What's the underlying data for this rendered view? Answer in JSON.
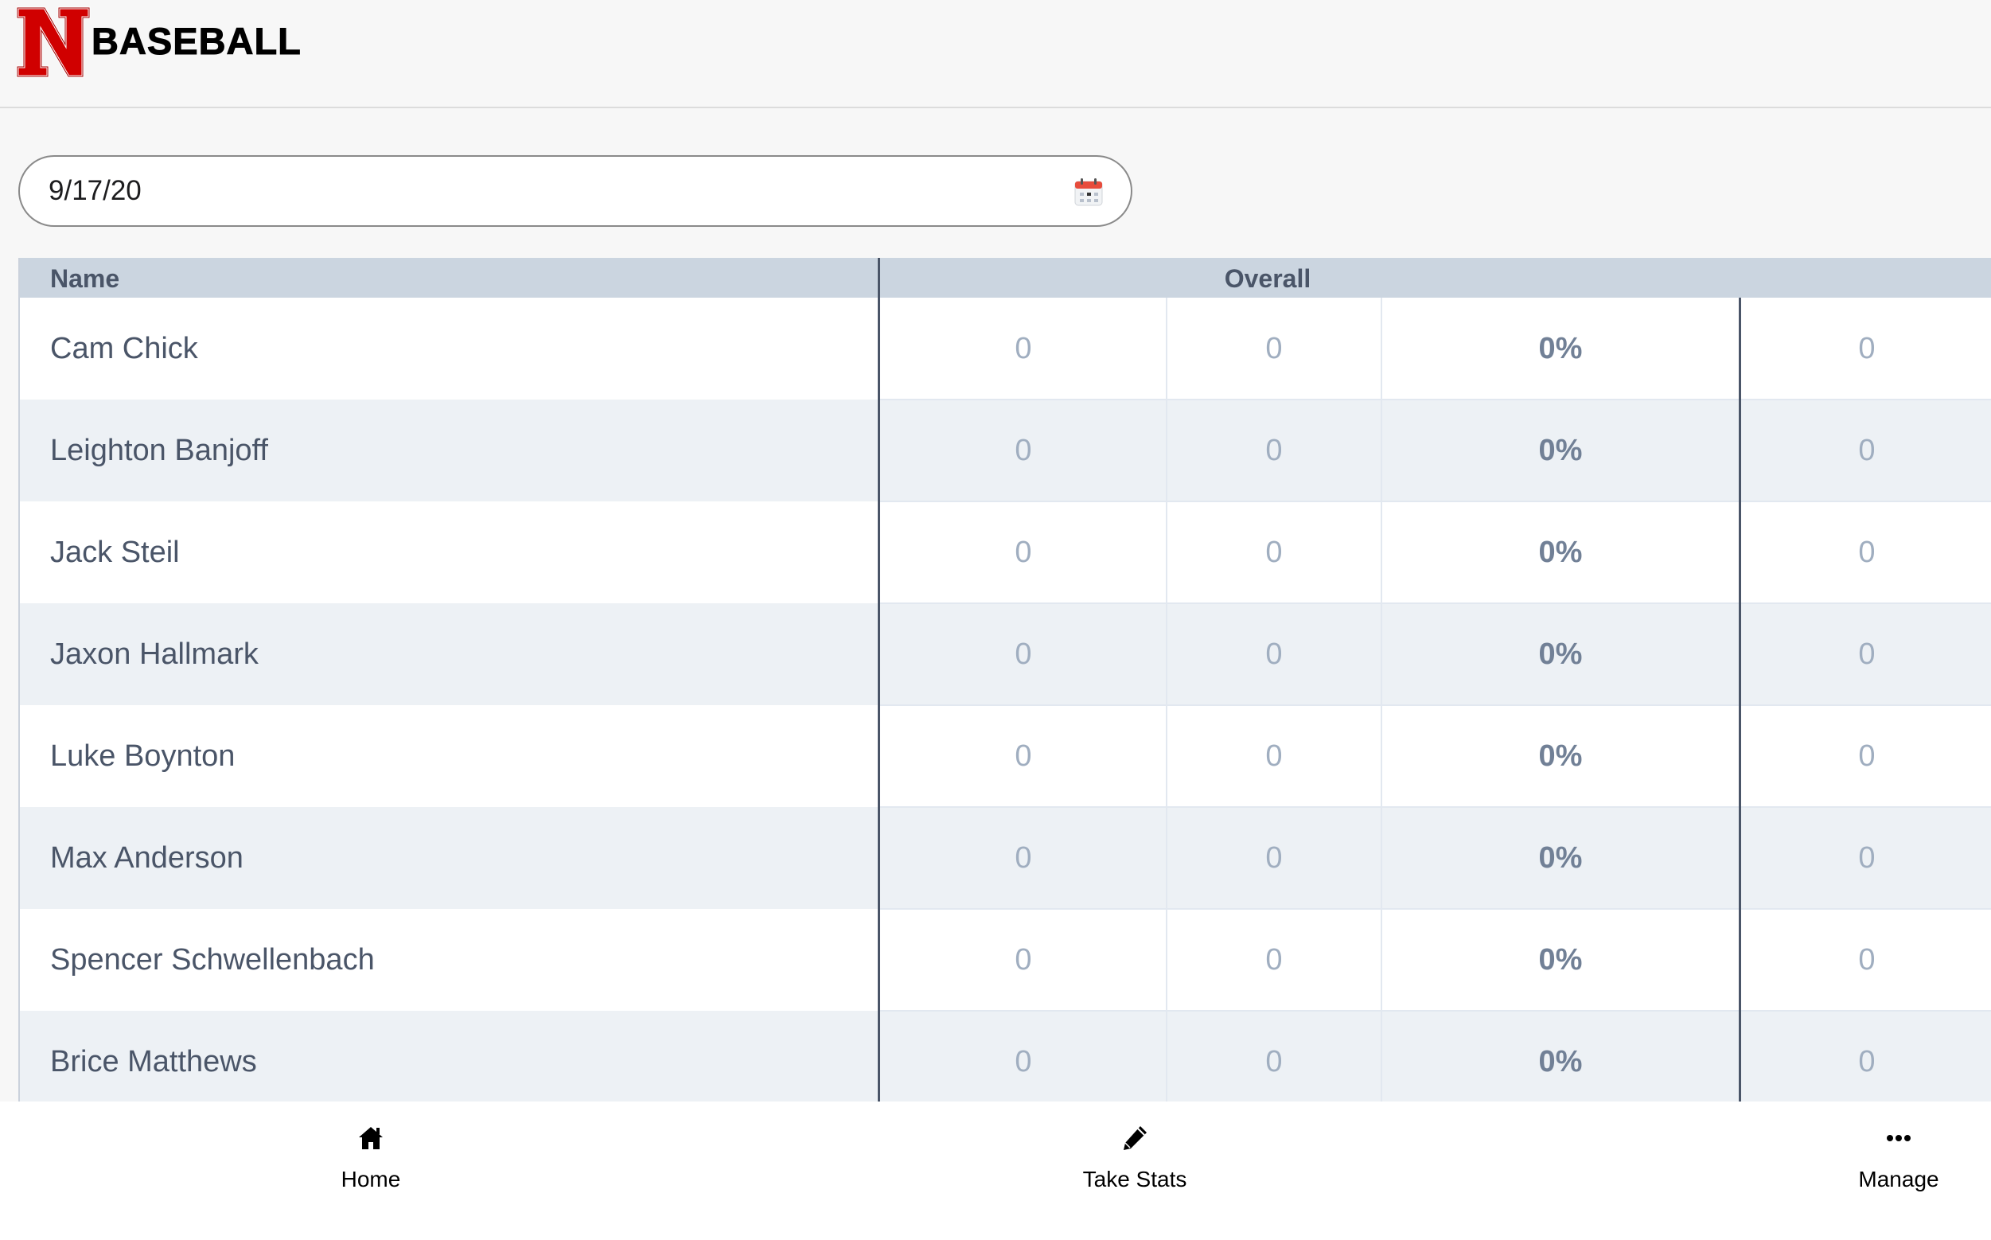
{
  "header": {
    "logo_letter": "N",
    "brand": "BASEBALL"
  },
  "date_filter": {
    "value": "9/17/20",
    "icon": "calendar-icon"
  },
  "table": {
    "columns": {
      "name": "Name",
      "overall": "Overall"
    },
    "rows": [
      {
        "name": "Cam Chick",
        "c1": "0",
        "c2": "0",
        "pct": "0%",
        "c4": "0"
      },
      {
        "name": "Leighton Banjoff",
        "c1": "0",
        "c2": "0",
        "pct": "0%",
        "c4": "0"
      },
      {
        "name": "Jack Steil",
        "c1": "0",
        "c2": "0",
        "pct": "0%",
        "c4": "0"
      },
      {
        "name": "Jaxon Hallmark",
        "c1": "0",
        "c2": "0",
        "pct": "0%",
        "c4": "0"
      },
      {
        "name": "Luke Boynton",
        "c1": "0",
        "c2": "0",
        "pct": "0%",
        "c4": "0"
      },
      {
        "name": "Max Anderson",
        "c1": "0",
        "c2": "0",
        "pct": "0%",
        "c4": "0"
      },
      {
        "name": "Spencer Schwellenbach",
        "c1": "0",
        "c2": "0",
        "pct": "0%",
        "c4": "0"
      },
      {
        "name": "Brice Matthews",
        "c1": "0",
        "c2": "0",
        "pct": "0%",
        "c4": "0"
      }
    ]
  },
  "bottom_nav": {
    "items": [
      {
        "label": "Home",
        "icon": "home-icon"
      },
      {
        "label": "Take Stats",
        "icon": "pencil-icon"
      },
      {
        "label": "Manage",
        "icon": "more-icon"
      }
    ]
  },
  "colors": {
    "brand_red": "#d00000",
    "header_bg": "#cbd5e0",
    "row_alt": "#edf1f5",
    "text": "#4a5568",
    "muted": "#a0aec0"
  }
}
